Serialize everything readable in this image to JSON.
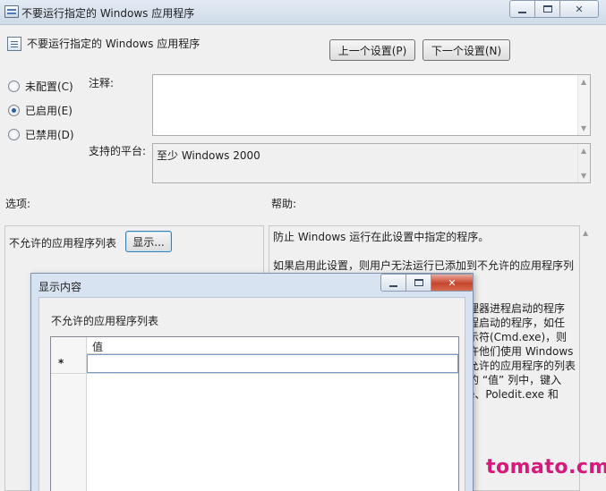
{
  "main_window": {
    "title": "不要运行指定的 Windows 应用程序",
    "header_title": "不要运行指定的 Windows 应用程序",
    "prev_button": "上一个设置(P)",
    "next_button": "下一个设置(N)",
    "radios": [
      {
        "label": "未配置(C)",
        "checked": false
      },
      {
        "label": "已启用(E)",
        "checked": true
      },
      {
        "label": "已禁用(D)",
        "checked": false
      }
    ],
    "comment_label": "注释:",
    "comment_value": "",
    "platform_label": "支持的平台:",
    "platform_value": "至少 Windows 2000",
    "options_label": "选项:",
    "help_label": "帮助:",
    "options": {
      "list_label": "不允许的应用程序列表",
      "show_button": "显示..."
    },
    "help_lines": [
      "防止 Windows 运行在此设置中指定的程序。",
      "",
      "如果启用此设置，则用户无法运行已添加到不允许的应用程序列",
      "表中的程序。",
      "",
      "理器进程启动的程序",
      "程启动的程序，如任",
      "示符(Cmd.exe)，则",
      "许他们使用 Windows",
      "允许的应用程序的列表",
      "的 “值” 列中，键入",
      "e、Poledit.exe 和"
    ]
  },
  "dialog": {
    "title": "显示内容",
    "list_label": "不允许的应用程序列表",
    "column_header": "值",
    "new_row_marker": "*",
    "new_row_value": ""
  },
  "watermark": "tomato.cm",
  "colors": {
    "accent": "#2a5fa8",
    "close_red": "#c7452c",
    "watermark": "#d6197b"
  }
}
